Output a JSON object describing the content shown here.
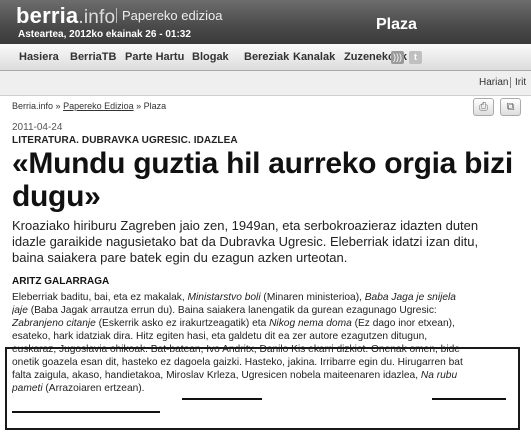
{
  "header": {
    "logo_main": "berria",
    "logo_suffix": ".info",
    "edition": "Papereko edizioa",
    "dateline": "Asteartea, 2012ko ekainak 26 - 01:32",
    "section": "Plaza"
  },
  "nav": {
    "items": [
      "Hasiera",
      "BerriaTB",
      "Parte Hartu",
      "Blogak",
      "Bereziak",
      "Kanalak",
      "Zuzenekoak"
    ],
    "icons": [
      "rss-icon",
      "twitter-icon"
    ]
  },
  "util": {
    "item1": "Harian",
    "item2": "Irit"
  },
  "breadcrumb": {
    "home": "Berria.info",
    "sep1": "»",
    "edition": "Papereko Edizioa",
    "sep2": "»",
    "section": "Plaza"
  },
  "article": {
    "date": "2011-04-24",
    "kicker": "LITERATURA. DUBRAVKA UGRESIC. IDAZLEA",
    "headline": "«Mundu guztia hil aurreko orgia bizi dugu»",
    "lead": "Kroaziako hiriburu Zagreben jaio zen, 1949an, eta serbokroazieraz idazten duten idazle garaikide nagusietako bat da Dubravka Ugresic. Eleberriak idatzi izan ditu, baina saiakera pare batek egin du ezagun azken urteotan.",
    "author": "ARITZ GALARRAGA",
    "body_lines": [
      [
        "Eleberriak baditu, bai, eta ez makalak, ",
        {
          "i": "Ministarstvo boli"
        },
        " (Minaren ministerioa), ",
        {
          "i": "Baba Jaga je snijela"
        }
      ],
      [
        {
          "i": "jaje"
        },
        " (Baba Jagak arrautza errun du). Baina saiakera lanengatik da gurean ezagunago Ugresic:"
      ],
      [
        {
          "i": "Zabranjeno citanje"
        },
        " (Eskerrik asko ez irakurtzeagatik) eta ",
        {
          "i": "Nikog nema doma"
        },
        " (Ez dago inor etxean),"
      ],
      [
        "esateko, hark idatziak dira. Hitz egiten hasi, eta galdetu dit ea zer autore ezagutzen ditugun,"
      ],
      [
        "euskaraz, Jugoslavia ohikoak. Bat-batean, Ivo Andritx, Danilo Kis ekarri dizkiot. Onenak omen, bide"
      ],
      [
        "onetik goazela esan dit, hasteko ez dagoela gaizki. Hasteko, jakina. Irribarre egin du. Hirugarren bat"
      ],
      [
        "falta zaigula, akaso, handietakoa, ",
        {
          "u": "Miroslav Krleza"
        },
        ", Ugresicen nobela maiteenaren idazlea, ",
        {
          "iu": "Na rubu"
        }
      ],
      [
        {
          "iu": "pameti"
        },
        {
          "u": " (Arrazoiaren ertzean)"
        },
        "."
      ]
    ]
  }
}
